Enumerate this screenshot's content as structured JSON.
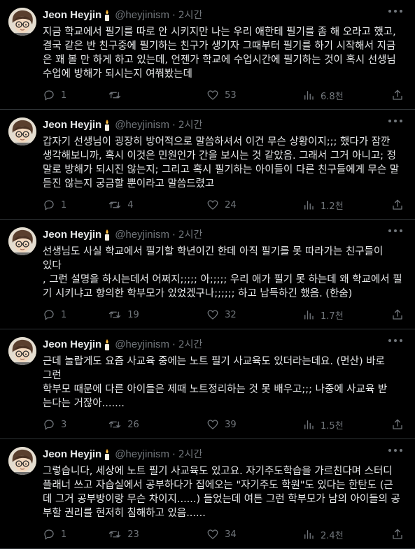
{
  "tweets": [
    {
      "name": "Jeon Heyjin",
      "handle": "@heyjinism",
      "sep": "·",
      "time": "2시간",
      "text": "지금 학교에서 필기를 따로 안 시키지만 나는 우리 애한테 필기를 좀 해 오라고 했고,\n결국 같은 반 친구중에 필기하는 친구가 생기자 그때부터 필기를 하기 시작해서 지금\n은 꽤 볼 만 하게 하고 있는데, 언젠가 학교에 수업시간에 필기하는 것이 혹시 선생님\n수업에 방해가 되시는지 여쭤봤는데",
      "replies": "1",
      "retweets": "",
      "likes": "53",
      "views": "6.8천"
    },
    {
      "name": "Jeon Heyjin",
      "handle": "@heyjinism",
      "sep": "·",
      "time": "2시간",
      "text": "갑자기 선생님이 굉장히 방어적으로 말씀하셔서 이건 무슨 상황이지;;; 했다가 잠깐\n생각해보니까, 혹시 이것은 민원인가 간을 보시는 것 같았음. 그래서 그거 아니고; 정\n말로 방해가 되시진 않는지; 그리고 혹시 필기하는 아이들이 다른 친구들에게 무슨 말\n듣진 않는지 궁금할 뿐이라고 말씀드렸고",
      "replies": "1",
      "retweets": "4",
      "likes": "24",
      "views": "1.2천"
    },
    {
      "name": "Jeon Heyjin",
      "handle": "@heyjinism",
      "sep": "·",
      "time": "2시간",
      "text": "선생님도 사실 학교에서 필기할 학년이긴 한데 아직 필기를 못 따라가는 친구들이 있다\n, 그런 설명을 하시는데서 어쩌지;;;;; 아;;;;; 우리 애가 필기 못 하는데 왜 학교에서 필\n기 시키냐고 항의한 학부모가 있었겠구나;;;;;; 하고 납득하긴 했음. (한숨)",
      "replies": "1",
      "retweets": "19",
      "likes": "32",
      "views": "1.7천"
    },
    {
      "name": "Jeon Heyjin",
      "handle": "@heyjinism",
      "sep": "·",
      "time": "2시간",
      "text": "근데 놀랍게도 요즘 사교육 중에는 노트 필기 사교육도 있더라는데요. (먼산)  바로 그런\n학부모 때문에 다른 아이들은 제때 노트정리하는 것 못 배우고;;; 나중에 사교육 받\n는다는 거잖아.......",
      "replies": "3",
      "retweets": "26",
      "likes": "39",
      "views": "1.5천"
    },
    {
      "name": "Jeon Heyjin",
      "handle": "@heyjinism",
      "sep": "·",
      "time": "2시간",
      "text": "그렇습니다, 세상에 노트 필기 사교육도 있고요. 자기주도학습을 가르친다며 스터디\n플래너 쓰고 자습실에서 공부하다가 집에오는 \"자기주도 학원\"도 있다는 한탄도 (근\n데 그거 공부방이랑 무슨 차이지......) 들었는데 여튼 그런 학부모가 남의 아이들의 공\n부할 권리를 현저히 침해하고 있음......",
      "replies": "1",
      "retweets": "23",
      "likes": "34",
      "views": "2.4천"
    }
  ],
  "colors": {
    "bg": "#000000",
    "text": "#e7e9ea",
    "muted": "#71767b",
    "border": "#2f3336"
  },
  "icons": {
    "more": "more-horizontal-icon",
    "reply": "reply-bubble-icon",
    "retweet": "retweet-arrows-icon",
    "like": "heart-icon",
    "views": "views-bar-chart-icon",
    "share": "share-upload-icon",
    "badge": "candle-icon",
    "avatar": "cartoon-face-avatar"
  }
}
